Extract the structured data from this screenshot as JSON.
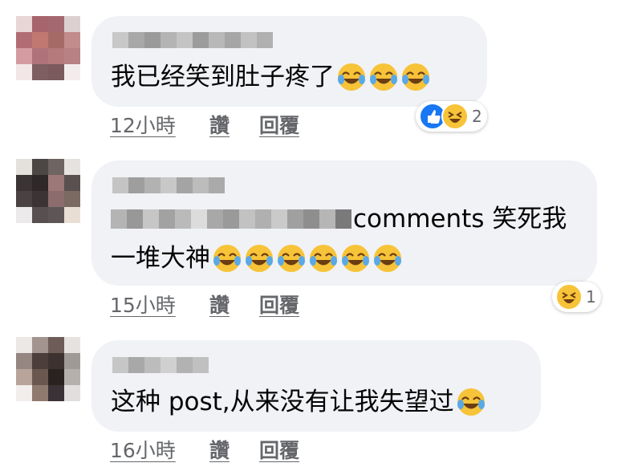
{
  "comments": [
    {
      "text": "我已经笑到肚子疼了",
      "emoji_count": 3,
      "time": "12小時",
      "like_label": "讚",
      "reply_label": "回覆",
      "reaction_count": "2",
      "reactions": [
        "like-icon",
        "haha-icon"
      ]
    },
    {
      "text_line1": "comments 笑死我",
      "text_line2": "一堆大神",
      "emoji_count": 6,
      "time": "15小時",
      "like_label": "讚",
      "reply_label": "回覆",
      "reaction_count": "1",
      "reactions": [
        "haha-icon"
      ]
    },
    {
      "text": "这种 post,从来没有让我失望过",
      "emoji_count": 1,
      "time": "16小時",
      "like_label": "讚",
      "reply_label": "回覆"
    }
  ],
  "colors": {
    "bubble": "#f0f2f5",
    "meta_text": "#65676b",
    "like_blue": "#1877f2",
    "haha_yellow": "#f7c338"
  }
}
